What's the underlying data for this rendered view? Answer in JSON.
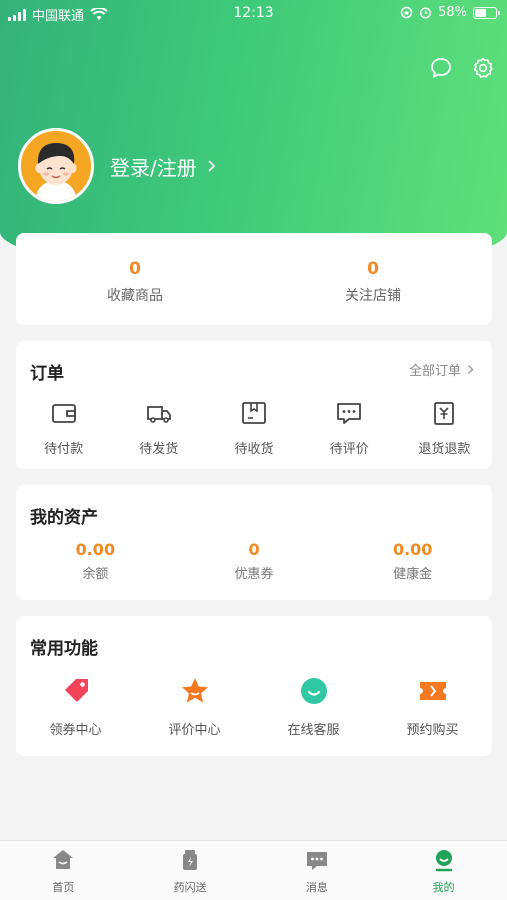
{
  "status_bar": {
    "carrier": "中国联通",
    "time": "12:13",
    "battery": "58%",
    "battery_level": 0.58
  },
  "profile": {
    "login_text": "登录/注册"
  },
  "stats": [
    {
      "value": "0",
      "label": "收藏商品"
    },
    {
      "value": "0",
      "label": "关注店铺"
    }
  ],
  "orders": {
    "title": "订单",
    "all_label": "全部订单",
    "items": [
      {
        "label": "待付款",
        "icon": "wallet-icon"
      },
      {
        "label": "待发货",
        "icon": "truck-icon"
      },
      {
        "label": "待收货",
        "icon": "package-icon"
      },
      {
        "label": "待评价",
        "icon": "comment-icon"
      },
      {
        "label": "退货退款",
        "icon": "refund-icon"
      }
    ]
  },
  "assets": {
    "title": "我的资产",
    "items": [
      {
        "value": "0.00",
        "label": "余额"
      },
      {
        "value": "0",
        "label": "优惠券"
      },
      {
        "value": "0.00",
        "label": "健康金"
      }
    ]
  },
  "functions": {
    "title": "常用功能",
    "items": [
      {
        "label": "领券中心",
        "icon": "coupon-tag-icon"
      },
      {
        "label": "评价中心",
        "icon": "star-icon"
      },
      {
        "label": "在线客服",
        "icon": "service-chat-icon"
      },
      {
        "label": "预约购买",
        "icon": "ticket-icon"
      }
    ]
  },
  "tabbar": [
    {
      "label": "首页",
      "icon": "home-icon"
    },
    {
      "label": "药闪送",
      "icon": "medicine-bottle-icon"
    },
    {
      "label": "消息",
      "icon": "message-icon"
    },
    {
      "label": "我的",
      "icon": "user-icon"
    }
  ],
  "colors": {
    "brand_green": "#3fca7a",
    "accent_orange": "#f08a24",
    "active_tab": "#22a35a"
  }
}
